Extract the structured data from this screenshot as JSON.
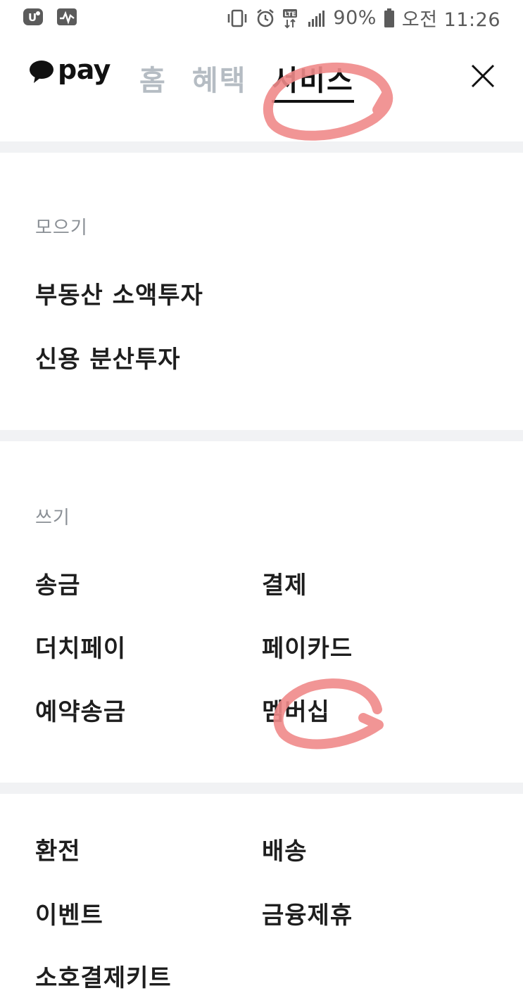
{
  "status_bar": {
    "battery": "90%",
    "time": "오전 11:26"
  },
  "header": {
    "logo_text": "pay",
    "tabs": [
      "홈",
      "혜택",
      "서비스"
    ],
    "active_tab": "서비스"
  },
  "sections": {
    "collect": {
      "label": "모으기",
      "items": [
        "부동산 소액투자",
        "신용 분산투자"
      ]
    },
    "spend": {
      "label": "쓰기",
      "items": [
        "송금",
        "결제",
        "더치페이",
        "페이카드",
        "예약송금",
        "멤버십"
      ]
    },
    "etc": {
      "items": [
        "환전",
        "배송",
        "이벤트",
        "금융제휴",
        "소호결제키트"
      ]
    }
  },
  "colors": {
    "annotation": "#f08a8a",
    "inactive_tab": "#b5bcc3",
    "divider": "#f1f2f4"
  }
}
